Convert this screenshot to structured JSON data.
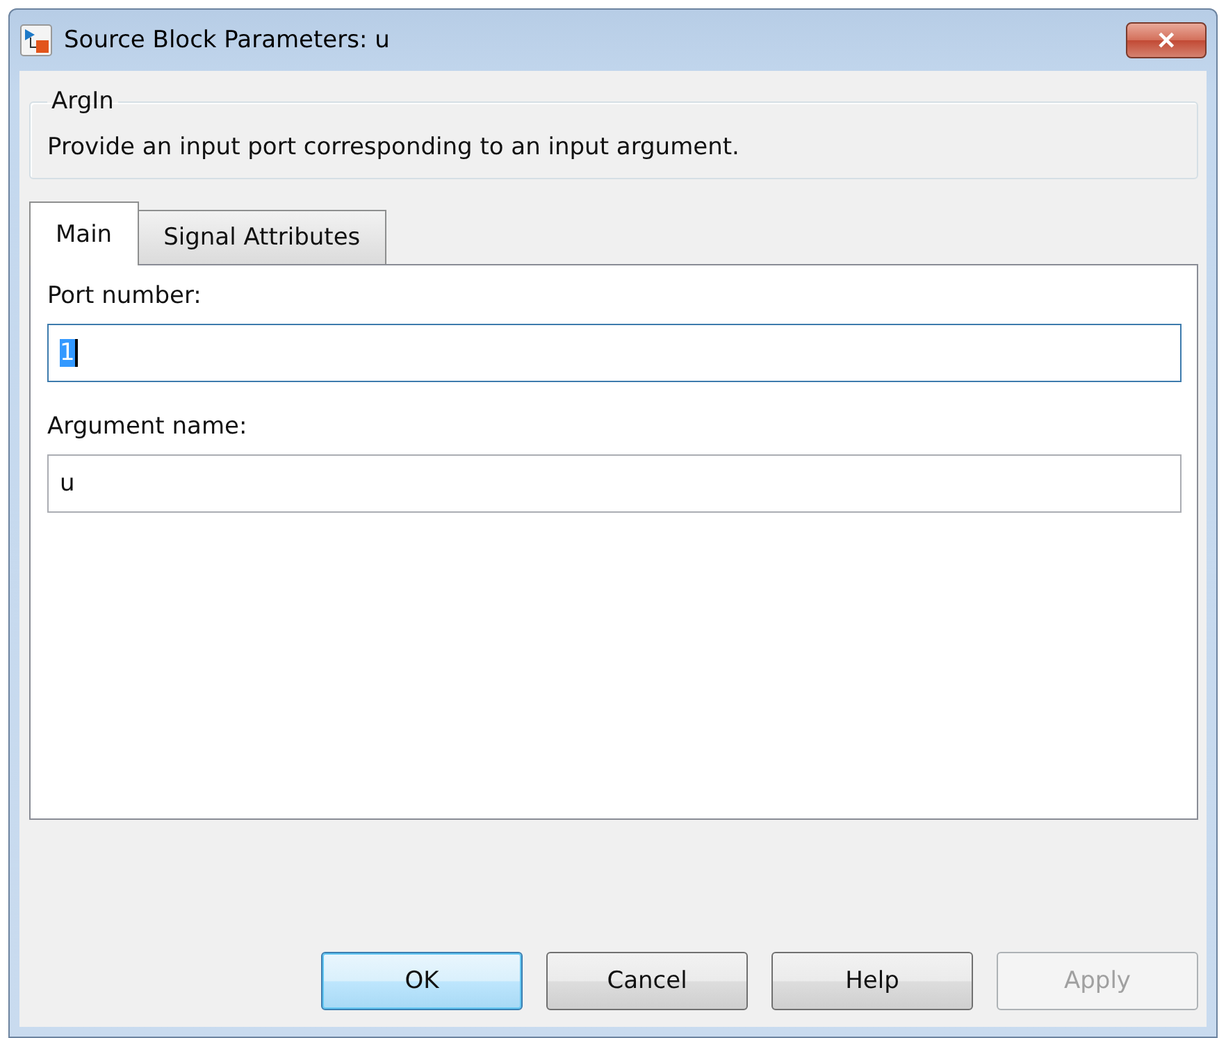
{
  "window": {
    "title": "Source Block Parameters: u",
    "close": "✕"
  },
  "group": {
    "title": "ArgIn",
    "description": "Provide an input port corresponding to an input argument."
  },
  "tabs": [
    {
      "label": "Main",
      "selected": true
    },
    {
      "label": "Signal Attributes",
      "selected": false
    }
  ],
  "fields": [
    {
      "label": "Port number:",
      "value": "1",
      "focused": true
    },
    {
      "label": "Argument name:",
      "value": "u",
      "focused": false
    }
  ],
  "buttons": [
    {
      "label": "OK",
      "default": true,
      "disabled": false
    },
    {
      "label": "Cancel",
      "default": false,
      "disabled": false
    },
    {
      "label": "Help",
      "default": false,
      "disabled": false
    },
    {
      "label": "Apply",
      "default": false,
      "disabled": true
    }
  ]
}
